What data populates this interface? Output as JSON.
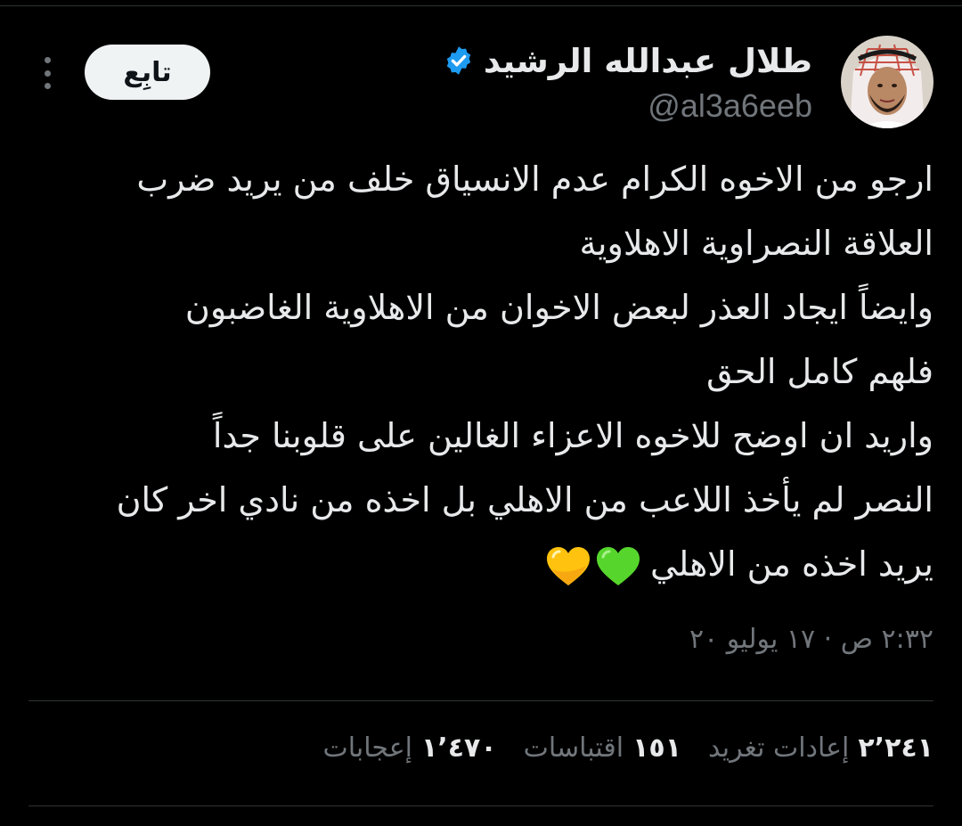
{
  "author": {
    "display_name": "طلال عبدالله الرشيد",
    "handle": "@al3a6eeb",
    "verified": true
  },
  "actions": {
    "follow_label": "تابِع",
    "more_icon": "more-vertical-icon"
  },
  "tweet": {
    "lines": [
      "ارجو من الاخوه الكرام عدم الانسياق خلف من يريد ضرب",
      "العلاقة النصراوية الاهلاوية",
      "وايضاً ايجاد العذر لبعض الاخوان من الاهلاوية الغاضبون",
      "فلهم كامل الحق",
      "واريد ان اوضح للاخوه الاعزاء الغالين على قلوبنا جداً",
      "النصر لم يأخذ اللاعب من الاهلي بل اخذه من نادي اخر كان",
      "يريد اخذه من الاهلي"
    ],
    "emoji": [
      "green-heart",
      "yellow-heart"
    ],
    "timestamp": "٢:٣٢ ص · ١٧ يوليو ٢٠"
  },
  "stats": {
    "retweets": {
      "count": "٢٬٢٤١",
      "label": "إعادات تغريد"
    },
    "quotes": {
      "count": "١٥١",
      "label": "اقتباسات"
    },
    "likes": {
      "count": "١٬٤٧٠",
      "label": "إعجابات"
    }
  },
  "colors": {
    "background": "#000000",
    "text": "#e7e9ea",
    "secondary": "#71767b",
    "divider": "#2f3336",
    "verified_badge": "#1d9bf0",
    "follow_button_bg": "#eff3f4",
    "green_heart": "#56d62c",
    "yellow_heart": "#ffc20e"
  }
}
